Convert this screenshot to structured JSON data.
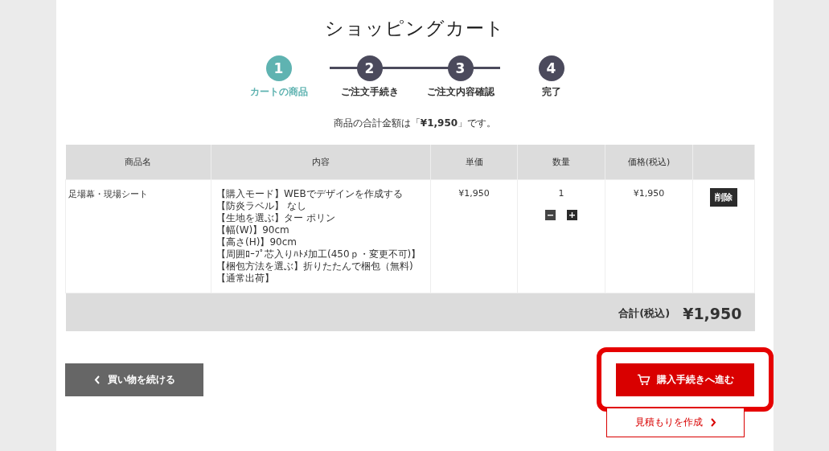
{
  "title": "ショッピングカート",
  "steps": [
    {
      "number": "1",
      "label": "カートの商品",
      "selected": true
    },
    {
      "number": "2",
      "label": "ご注文手続き",
      "selected": false
    },
    {
      "number": "3",
      "label": "ご注文内容確認",
      "selected": false
    },
    {
      "number": "4",
      "label": "完了",
      "selected": false
    }
  ],
  "summary": "商品の合計金額は「**¥1,950**」です。",
  "table": {
    "columns": [
      "商品名",
      "内容",
      "単価",
      "数量",
      "価格(税込)"
    ],
    "rows": [
      {
        "name": "足場幕・現場シート",
        "details": [
          "【購入モード】WEBでデザインを作成する",
          "【防炎ラベル】 なし",
          "【生地を選ぶ】ター ポリン",
          "【幅(W)】90cm",
          "【高さ(H)】90cm",
          "【周囲ﾛｰﾌﾟ芯入りﾊﾄﾒ加工(450ｐ・変更不可)】",
          "【梱包方法を選ぶ】折りたたんで梱包（無料)",
          "【通常出荷】"
        ],
        "unit_price": "¥1,950",
        "quantity": "1",
        "price": "¥1,950",
        "delete": "削除"
      }
    ],
    "total_label": "合計(税込)",
    "total": "¥1,950"
  },
  "buttons": {
    "continue": "買い物を続ける",
    "checkout": "購入手続きへ進む",
    "quote": "見積もりを作成"
  }
}
